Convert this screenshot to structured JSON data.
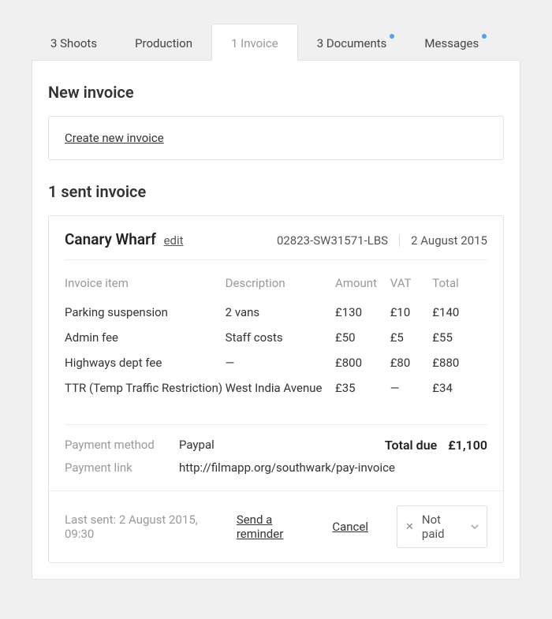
{
  "tabs": [
    {
      "label": "3 Shoots",
      "active": false,
      "badge": false
    },
    {
      "label": "Production",
      "active": false,
      "badge": false
    },
    {
      "label": "1 Invoice",
      "active": true,
      "badge": false
    },
    {
      "label": "3 Documents",
      "active": false,
      "badge": true
    },
    {
      "label": "Messages",
      "active": false,
      "badge": true
    }
  ],
  "new_invoice": {
    "heading": "New invoice",
    "create_link": "Create new invoice"
  },
  "sent": {
    "heading": "1 sent invoice"
  },
  "invoice": {
    "title": "Canary Wharf",
    "edit_label": "edit",
    "reference": "02823-SW31571-LBS",
    "date": "2 August 2015",
    "columns": {
      "item": "Invoice item",
      "description": "Description",
      "amount": "Amount",
      "vat": "VAT",
      "total": "Total"
    },
    "rows": [
      {
        "item": "Parking suspension",
        "description": "2 vans",
        "amount": "£130",
        "vat": "£10",
        "total": "£140"
      },
      {
        "item": "Admin fee",
        "description": "Staff costs",
        "amount": "£50",
        "vat": "£5",
        "total": "£55"
      },
      {
        "item": "Highways dept fee",
        "description": "—",
        "amount": "£800",
        "vat": "£80",
        "total": "£880"
      },
      {
        "item": "TTR (Temp Traffic Restriction)",
        "description": "West India Avenue",
        "amount": "£35",
        "vat": "—",
        "total": "£34"
      }
    ],
    "payment": {
      "method_label": "Payment method",
      "method_value": "Paypal",
      "link_label": "Payment link",
      "link_value": "http://filmapp.org/southwark/pay-invoice",
      "total_due_label": "Total due",
      "total_due_value": "£1,100"
    },
    "footer": {
      "last_sent_label": "Last sent:",
      "last_sent_value": "2 August 2015, 09:30",
      "reminder_label": "Send a reminder",
      "cancel_label": "Cancel",
      "status_value": "Not paid"
    }
  }
}
